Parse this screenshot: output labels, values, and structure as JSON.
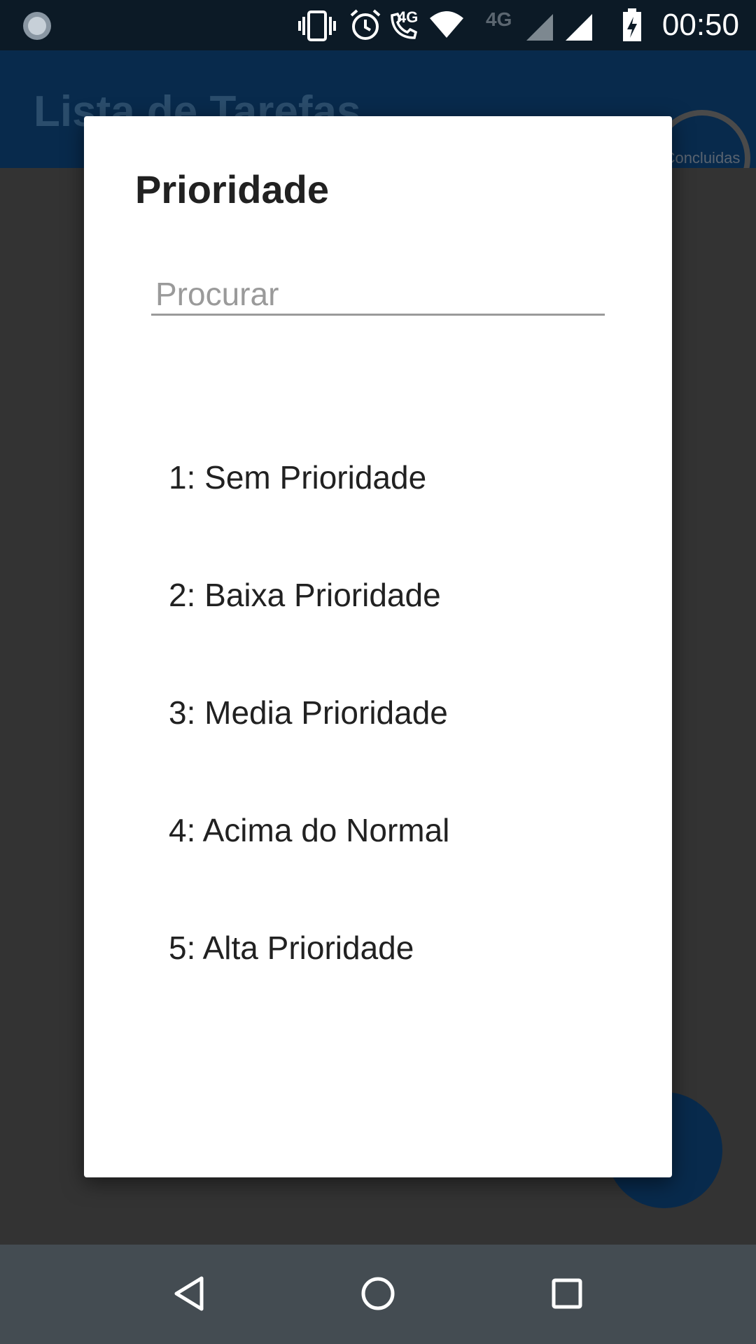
{
  "status_bar": {
    "time": "00:50",
    "network_label_1": "4G",
    "network_label_2": "4G",
    "icons": [
      "launcher-icon",
      "vibrate-icon",
      "alarm-icon",
      "volte-call-icon",
      "wifi-icon",
      "signal-icon",
      "battery-charging-icon"
    ]
  },
  "app": {
    "title": "Lista de Tarefas",
    "done_button_label": "Concluidas",
    "fab_icon": "add-icon",
    "colors": {
      "appbar": "#082a4c",
      "statusbar": "#0c1a26"
    }
  },
  "dialog": {
    "title": "Prioridade",
    "search_placeholder": "Procurar",
    "search_value": "",
    "options": [
      {
        "label": "1: Sem Prioridade"
      },
      {
        "label": "2: Baixa Prioridade"
      },
      {
        "label": "3: Media Prioridade"
      },
      {
        "label": "4: Acima do Normal"
      },
      {
        "label": "5: Alta Prioridade"
      }
    ]
  },
  "nav_bar": {
    "icons": [
      "back-icon",
      "home-icon",
      "recents-icon"
    ]
  }
}
